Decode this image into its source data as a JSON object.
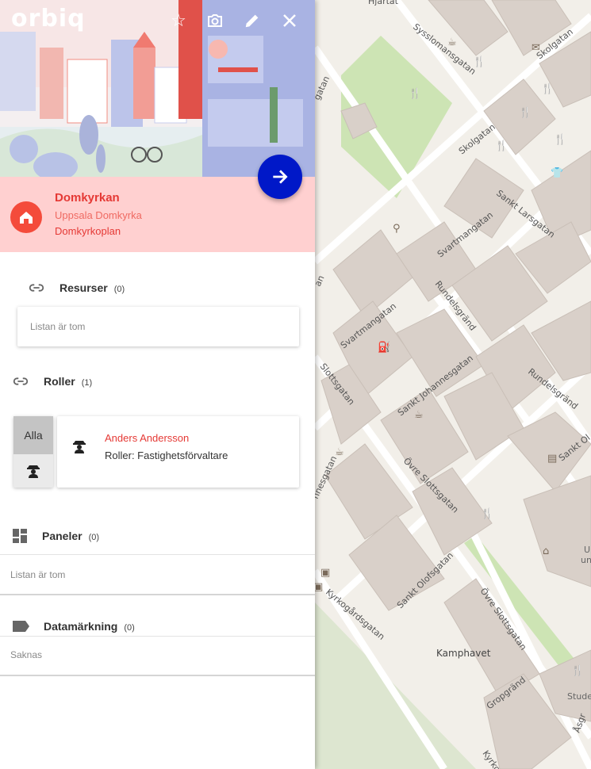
{
  "app": {
    "logo": "orbiq"
  },
  "header_icons": [
    "star-icon",
    "camera-icon",
    "pencil-icon",
    "close-icon"
  ],
  "place": {
    "title": "Domkyrkan",
    "subtitle": "Uppsala Domkyrka",
    "address": "Domkyrkoplan"
  },
  "sections": {
    "resurser": {
      "label": "Resurser",
      "count": "(0)",
      "empty": "Listan är tom"
    },
    "roller": {
      "label": "Roller",
      "count": "(1)",
      "filter_all": "Alla",
      "person_name": "Anders Andersson",
      "person_roles": "Roller: Fastighetsförvaltare"
    },
    "paneler": {
      "label": "Paneler",
      "count": "(0)",
      "empty": "Listan är tom"
    },
    "datamarkning": {
      "label": "Datamärkning",
      "count": "(0)",
      "empty": "Saknas"
    }
  },
  "map": {
    "streets": [
      "Sysslomansgatan",
      "Skolgatan",
      "Skolgatan",
      "Sankt Larsgatan",
      "Svartmangatan",
      "Rundelsgränd",
      "Svartmangatan",
      "Rundelsgränd",
      "Slottsgatan",
      "Sankt Johannesgatan",
      "Sankt Ol",
      "Övre Slottsgatan",
      "Sankt Olofsgatan",
      "Övre Slottsgatan",
      "Kyrkogårdsgatan",
      "Gropgränd",
      "Åsgr",
      "Kyrko",
      "Hjärtat",
      "nnesgatan",
      "gatan",
      "an"
    ],
    "places": [
      "Kamphavet",
      "U",
      "unn",
      "Studen"
    ]
  },
  "colors": {
    "accent_red": "#e53935",
    "fab_blue": "#0018c8",
    "info_bg": "#ffd0d0"
  }
}
